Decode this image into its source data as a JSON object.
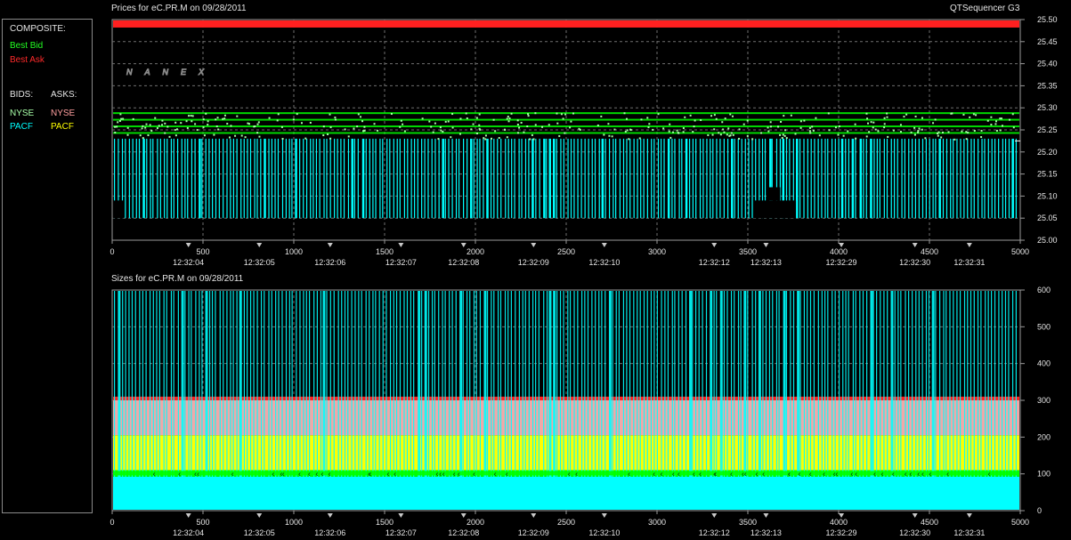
{
  "legend": {
    "composite_label": "COMPOSITE:",
    "best_bid": "Best Bid",
    "best_ask": "Best Ask",
    "bids_label": "BIDS:",
    "asks_label": "ASKS:",
    "bid_nyse": "NYSE",
    "ask_nyse": "NYSE",
    "bid_pacf": "PACF",
    "ask_pacf": "PACF"
  },
  "header": {
    "prices_title": "Prices for  eC.PR.M  on  09/28/2011",
    "sizes_title": "Sizes for  eC.PR.M  on  09/28/2011",
    "app_name": "QTSequencer G3",
    "watermark": "NANEX"
  },
  "colors": {
    "best_bid": "#00ff00",
    "best_ask": "#ff2020",
    "bid_nyse": "#a8ffa8",
    "ask_nyse": "#ff9f9f",
    "bid_pacf": "#00ffff",
    "ask_pacf": "#ffff00"
  },
  "chart_data": [
    {
      "type": "line",
      "title": "Prices for  eC.PR.M  on  09/28/2011",
      "xlim": [
        0,
        5000
      ],
      "ylim": [
        25.0,
        25.5
      ],
      "x_ticks": [
        0,
        500,
        1000,
        1500,
        2000,
        2500,
        3000,
        3500,
        4000,
        4500,
        5000
      ],
      "y_ticks": [
        "25.50",
        "25.45",
        "25.40",
        "25.35",
        "25.30",
        "25.25",
        "25.20",
        "25.15",
        "25.10",
        "25.05",
        "25.00"
      ],
      "time_labels": [
        {
          "x": 420,
          "label": "12:32:04"
        },
        {
          "x": 810,
          "label": "12:32:05"
        },
        {
          "x": 1200,
          "label": "12:32:06"
        },
        {
          "x": 1590,
          "label": "12:32:07"
        },
        {
          "x": 1935,
          "label": "12:32:08"
        },
        {
          "x": 2320,
          "label": "12:32:09"
        },
        {
          "x": 2710,
          "label": "12:32:10"
        },
        {
          "x": 3315,
          "label": "12:32:12"
        },
        {
          "x": 3600,
          "label": "12:32:13"
        },
        {
          "x": 4015,
          "label": "12:32:29"
        },
        {
          "x": 4420,
          "label": "12:32:30"
        },
        {
          "x": 4720,
          "label": "12:32:31"
        }
      ],
      "series": [
        {
          "name": "Best Ask",
          "values": [
            25.49,
            25.49
          ]
        },
        {
          "name": "Best Bid",
          "values": [
            25.27,
            25.27
          ]
        },
        {
          "name": "NYSE",
          "side": "bid",
          "values": [
            25.27,
            25.28,
            25.29
          ]
        },
        {
          "name": "PACF",
          "side": "bid",
          "values": [
            25.23,
            25.05
          ]
        }
      ]
    },
    {
      "type": "bar",
      "title": "Sizes for  eC.PR.M  on  09/28/2011",
      "xlim": [
        0,
        5000
      ],
      "ylim": [
        0,
        600
      ],
      "x_ticks": [
        0,
        500,
        1000,
        1500,
        2000,
        2500,
        3000,
        3500,
        4000,
        4500,
        5000
      ],
      "y_ticks": [
        "600",
        "500",
        "400",
        "300",
        "200",
        "100",
        "0"
      ],
      "series": [
        {
          "name": "PACF",
          "side": "bid",
          "values": [
            90,
            600
          ]
        },
        {
          "name": "Best Bid",
          "values": [
            100,
            100
          ]
        },
        {
          "name": "PACF",
          "side": "ask",
          "values": [
            200,
            200
          ]
        },
        {
          "name": "NYSE",
          "side": "ask",
          "values": [
            300,
            300
          ]
        },
        {
          "name": "Best Ask",
          "values": [
            310,
            310
          ]
        }
      ]
    }
  ]
}
